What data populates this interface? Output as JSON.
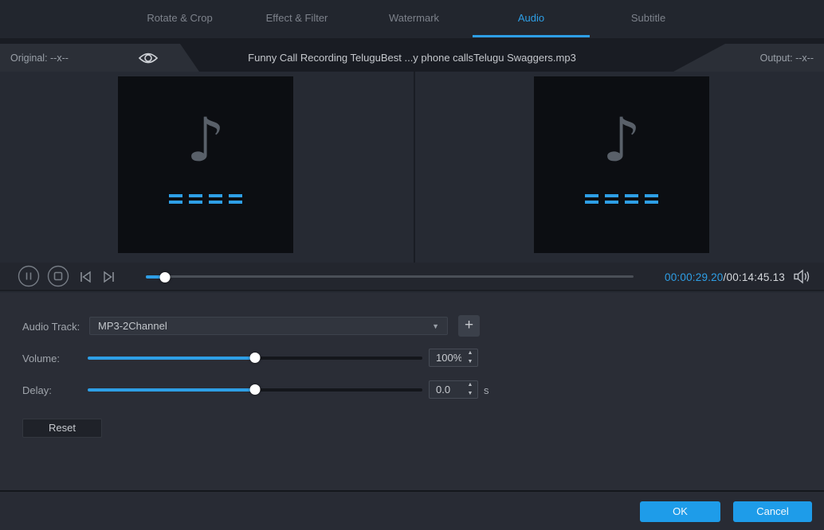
{
  "tabs": {
    "items": [
      {
        "label": "Rotate & Crop",
        "active": false
      },
      {
        "label": "Effect & Filter",
        "active": false
      },
      {
        "label": "Watermark",
        "active": false
      },
      {
        "label": "Audio",
        "active": true
      },
      {
        "label": "Subtitle",
        "active": false
      }
    ]
  },
  "header": {
    "original_label": "Original: --x--",
    "filename": "Funny Call Recording TeluguBest ...y phone callsTelugu Swaggers.mp3",
    "output_label": "Output: --x--"
  },
  "player": {
    "current_time": "00:00:29.20",
    "total_time": "/00:14:45.13",
    "progress_fill": "4%"
  },
  "audio_track": {
    "label": "Audio Track:",
    "selected": "MP3-2Channel",
    "add_button_label": "+"
  },
  "volume": {
    "label": "Volume:",
    "value": "100%",
    "fill": "50%"
  },
  "delay": {
    "label": "Delay:",
    "value": "0.0",
    "unit": "s",
    "fill": "50%"
  },
  "reset_button_label": "Reset",
  "footer": {
    "ok_label": "OK",
    "cancel_label": "Cancel"
  },
  "icons": {
    "music_note": "♪",
    "dropdown_arrow": "▼",
    "spin_up": "▲",
    "spin_down": "▼"
  },
  "colors": {
    "accent_blue": "#2e9fe6",
    "button_blue": "#1e9ce9"
  }
}
